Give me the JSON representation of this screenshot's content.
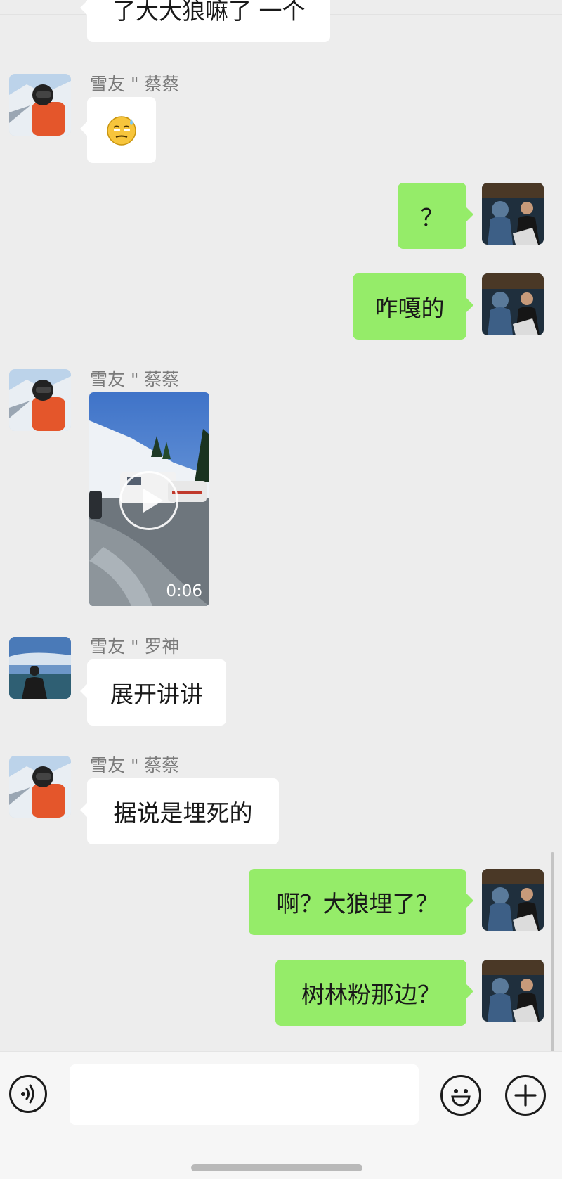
{
  "messages": {
    "partial_top": "了大大狼嘛了 一个",
    "m1": {
      "sender": "雪友 \" 蔡蔡",
      "emoji": "sweat-smile-emoji"
    },
    "m2": {
      "text": "？"
    },
    "m3": {
      "text": "咋嘎的"
    },
    "m4": {
      "sender": "雪友 \" 蔡蔡",
      "video_duration": "0:06"
    },
    "m5": {
      "sender": "雪友 \" 罗神",
      "text": "展开讲讲"
    },
    "m6": {
      "sender": "雪友 \" 蔡蔡",
      "text": "据说是埋死的"
    },
    "m7": {
      "text": "啊？大狼埋了？"
    },
    "m8": {
      "text": "树林粉那边？"
    }
  },
  "input": {
    "value": "",
    "placeholder": ""
  },
  "icons": {
    "voice": "voice-input-icon",
    "emoji": "smiley-icon",
    "plus": "plus-icon"
  },
  "colors": {
    "background": "#ededed",
    "outgoing_bubble": "#95ec69",
    "incoming_bubble": "#ffffff"
  }
}
